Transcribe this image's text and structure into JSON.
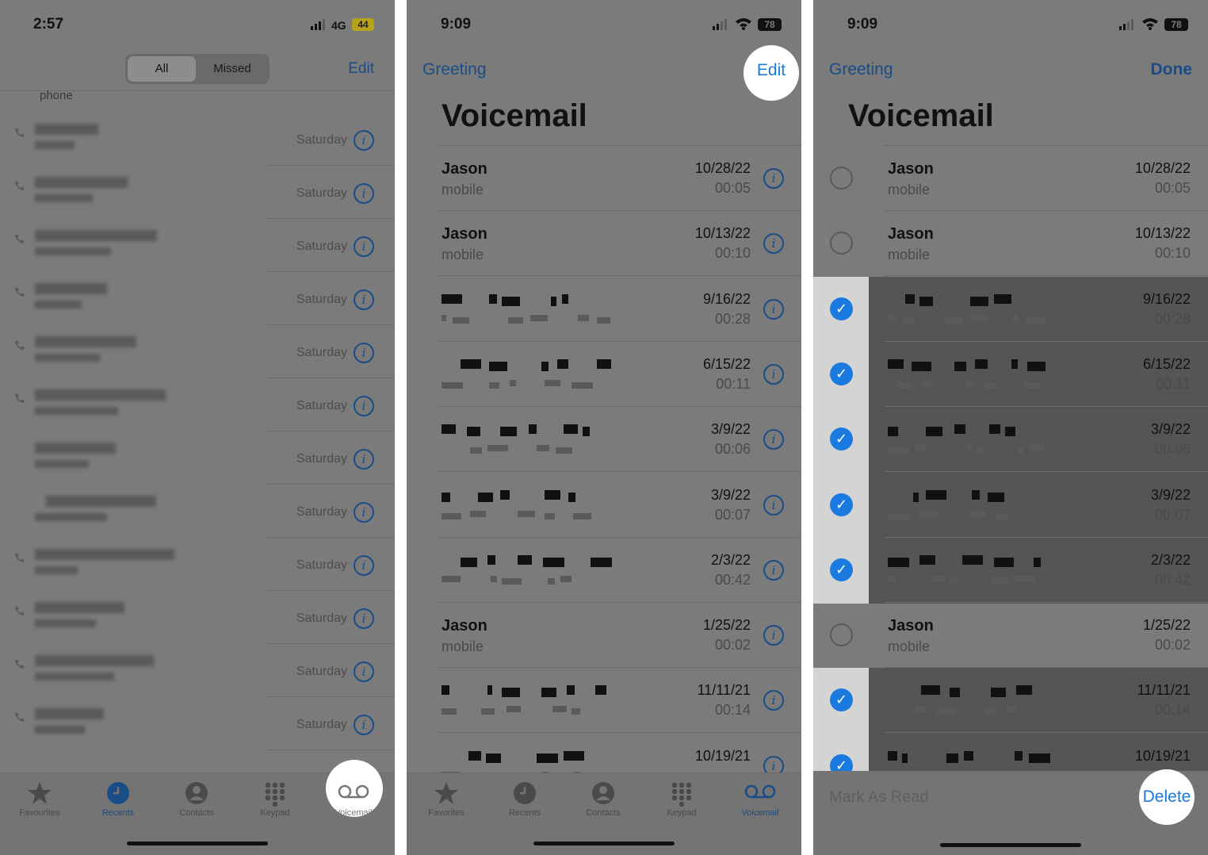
{
  "panel1": {
    "status": {
      "time": "2:57",
      "network": "4G",
      "battery": "44"
    },
    "segments": [
      "All",
      "Missed"
    ],
    "edit_label": "Edit",
    "partial_label": "phone",
    "row_dates": [
      "Saturday",
      "Saturday",
      "Saturday",
      "Saturday",
      "Saturday",
      "Saturday",
      "Saturday",
      "Saturday",
      "Saturday",
      "Saturday",
      "Saturday",
      "Saturday"
    ],
    "tabs": [
      "Favourites",
      "Recents",
      "Contacts",
      "Keypad",
      "Voicemail"
    ]
  },
  "panel2": {
    "status": {
      "time": "9:09",
      "battery": "78"
    },
    "greeting_label": "Greeting",
    "edit_label": "Edit",
    "title": "Voicemail",
    "rows": [
      {
        "name": "Jason",
        "sub": "mobile",
        "date": "10/28/22",
        "duration": "00:05"
      },
      {
        "name": "Jason",
        "sub": "mobile",
        "date": "10/13/22",
        "duration": "00:10"
      },
      {
        "name": "",
        "sub": "",
        "date": "9/16/22",
        "duration": "00:28"
      },
      {
        "name": "",
        "sub": "",
        "date": "6/15/22",
        "duration": "00:11"
      },
      {
        "name": "",
        "sub": "",
        "date": "3/9/22",
        "duration": "00:06"
      },
      {
        "name": "",
        "sub": "",
        "date": "3/9/22",
        "duration": "00:07"
      },
      {
        "name": "",
        "sub": "",
        "date": "2/3/22",
        "duration": "00:42"
      },
      {
        "name": "Jason",
        "sub": "mobile",
        "date": "1/25/22",
        "duration": "00:02"
      },
      {
        "name": "",
        "sub": "",
        "date": "11/11/21",
        "duration": "00:14"
      },
      {
        "name": "",
        "sub": "",
        "date": "10/19/21",
        "duration": ""
      }
    ],
    "tabs": [
      "Favorites",
      "Recents",
      "Contacts",
      "Keypad",
      "Voicemail"
    ]
  },
  "panel3": {
    "status": {
      "time": "9:09",
      "battery": "78"
    },
    "greeting_label": "Greeting",
    "done_label": "Done",
    "title": "Voicemail",
    "rows": [
      {
        "name": "Jason",
        "sub": "mobile",
        "date": "10/28/22",
        "duration": "00:05",
        "selected": false
      },
      {
        "name": "Jason",
        "sub": "mobile",
        "date": "10/13/22",
        "duration": "00:10",
        "selected": false
      },
      {
        "name": "",
        "sub": "",
        "date": "9/16/22",
        "duration": "00:28",
        "selected": true
      },
      {
        "name": "",
        "sub": "",
        "date": "6/15/22",
        "duration": "00:11",
        "selected": true
      },
      {
        "name": "",
        "sub": "",
        "date": "3/9/22",
        "duration": "00:06",
        "selected": true
      },
      {
        "name": "",
        "sub": "",
        "date": "3/9/22",
        "duration": "00:07",
        "selected": true
      },
      {
        "name": "",
        "sub": "",
        "date": "2/3/22",
        "duration": "00:42",
        "selected": true
      },
      {
        "name": "Jason",
        "sub": "mobile",
        "date": "1/25/22",
        "duration": "00:02",
        "selected": false
      },
      {
        "name": "",
        "sub": "",
        "date": "11/11/21",
        "duration": "00:14",
        "selected": true
      },
      {
        "name": "",
        "sub": "",
        "date": "10/19/21",
        "duration": "",
        "selected": true
      }
    ],
    "mark_as_read_label": "Mark As Read",
    "delete_label": "Delete"
  },
  "colors": {
    "accent": "#1a7ae0",
    "accent_dim": "#1a4d86",
    "overlay_bg": "#7b7b7b",
    "highlight": "#ffffff"
  }
}
